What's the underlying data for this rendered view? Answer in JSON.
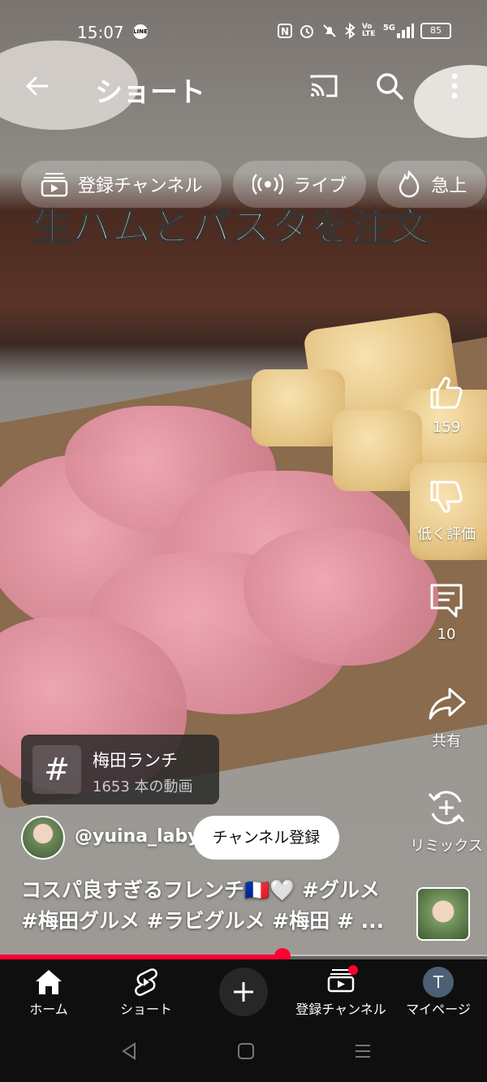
{
  "status_bar": {
    "time": "15:07",
    "line_label": "LINE",
    "icons": [
      "nfc-icon",
      "alarm-icon",
      "mute-icon",
      "bluetooth-icon",
      "volte-icon",
      "5g-signal-icon"
    ],
    "volte": "Vo LTE",
    "network": "5G",
    "battery": "85"
  },
  "header": {
    "title": "ショート"
  },
  "chips": [
    {
      "label": "登録チャンネル",
      "icon": "subscriptions-icon"
    },
    {
      "label": "ライブ",
      "icon": "live-icon"
    },
    {
      "label": "急上",
      "icon": "trending-icon"
    }
  ],
  "video": {
    "overlay_text": "生ハムとパスタを注文"
  },
  "actions": {
    "like_count": "159",
    "dislike_label": "低く評価",
    "comment_count": "10",
    "share_label": "共有",
    "remix_label": "リミックス"
  },
  "hashtag_card": {
    "symbol": "#",
    "tag": "梅田ランチ",
    "count": "1653 本の動画"
  },
  "channel": {
    "handle": "@yuina_laby",
    "subscribe_label": "チャンネル登録"
  },
  "description": {
    "line1": "コスパ良すぎるフレンチ🇫🇷🤍 #グルメ",
    "line2": "#梅田グルメ #ラビグルメ #梅田 # ..."
  },
  "progress": {
    "fraction": 0.58,
    "color": "#ff0033"
  },
  "bottom_nav": [
    {
      "label": "ホーム",
      "icon": "home-icon"
    },
    {
      "label": "ショート",
      "icon": "shorts-icon"
    },
    {
      "label": "",
      "icon": "create-icon"
    },
    {
      "label": "登録チャンネル",
      "icon": "subscriptions-icon"
    },
    {
      "label": "マイページ",
      "icon": "avatar-icon",
      "avatar_letter": "T"
    }
  ],
  "colors": {
    "accent": "#ff0033",
    "nav_bg": "#0f0f0f"
  }
}
